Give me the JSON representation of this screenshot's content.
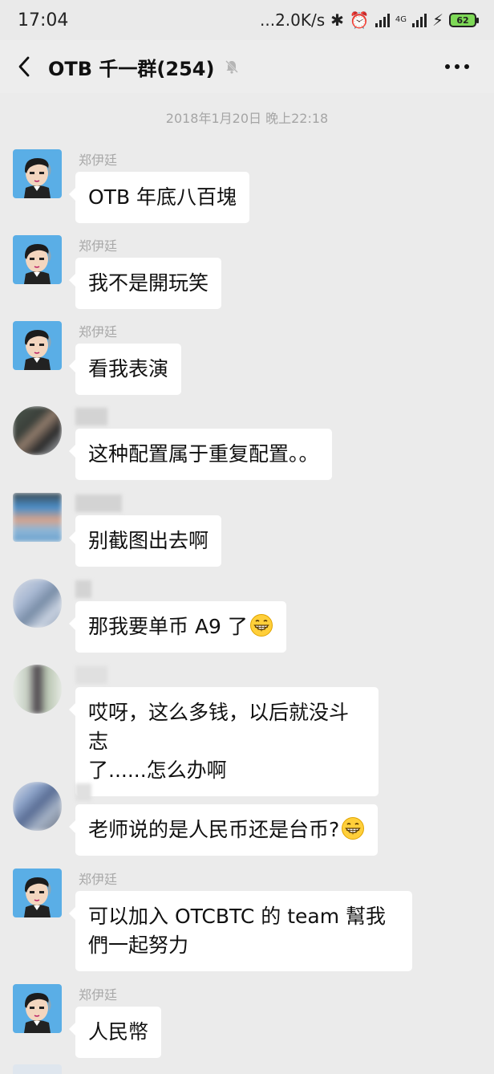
{
  "status": {
    "time": "17:04",
    "net_speed": "...2.0K/s",
    "network_label": "4G",
    "battery": "62"
  },
  "header": {
    "title": "OTB 千一群(254)"
  },
  "chat": {
    "timestamp": "2018年1月20日 晚上22:18",
    "messages": [
      {
        "sender": "郑伊廷",
        "text": "OTB 年底八百塊"
      },
      {
        "sender": "郑伊廷",
        "text": "我不是開玩笑"
      },
      {
        "sender": "郑伊廷",
        "text": "看我表演"
      },
      {
        "sender": "",
        "text": "这种配置属于重复配置。。"
      },
      {
        "sender": "",
        "text": "别截图出去啊"
      },
      {
        "sender": "",
        "text": "那我要单币 A9 了",
        "emoji": "grin"
      },
      {
        "sender": "",
        "text_line1": "哎呀，这么多钱，以后就没斗志",
        "text_line2": "了......怎么办啊"
      },
      {
        "sender": "",
        "text": "老师说的是人民币还是台币?",
        "emoji": "grin"
      },
      {
        "sender": "郑伊廷",
        "text_line1": "可以加入 OTCBTC 的 team 幫我",
        "text_line2": "們一起努力"
      },
      {
        "sender": "郑伊廷",
        "text": "人民幣"
      }
    ]
  },
  "icons": {
    "back": "chevron-left-icon",
    "mute": "bell-off-icon",
    "more": "more-icon",
    "emoji": "grinning-face-icon"
  },
  "colors": {
    "background": "#ebebeb",
    "bubble": "#ffffff",
    "avatar_bg": "#5aaee6"
  }
}
